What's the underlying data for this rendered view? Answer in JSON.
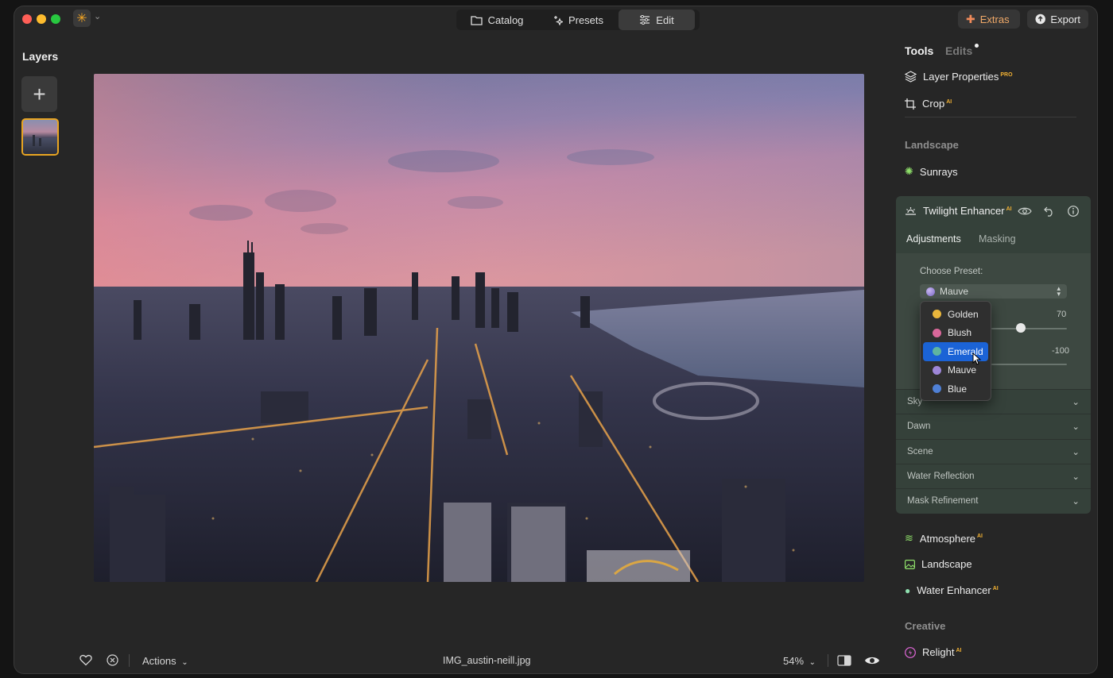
{
  "colors": {
    "accent": "#e8a522",
    "selection": "#1b63d6",
    "ai_badge": "#f0b033"
  },
  "topbar": {
    "tabs": [
      {
        "label": "Catalog",
        "icon": "folder-icon"
      },
      {
        "label": "Presets",
        "icon": "sparkle-icon"
      },
      {
        "label": "Edit",
        "icon": "sliders-icon",
        "active": true
      }
    ],
    "extras_label": "Extras",
    "export_label": "Export"
  },
  "layers": {
    "title": "Layers"
  },
  "bottombar": {
    "actions_label": "Actions",
    "filename": "IMG_austin-neill.jpg",
    "zoom": "54%"
  },
  "rightpanel": {
    "tab_tools": "Tools",
    "tab_edits": "Edits",
    "layer_properties": "Layer Properties",
    "pro_badge": "PRO",
    "ai_badge": "AI",
    "crop": "Crop",
    "section_landscape": "Landscape",
    "sunrays": "Sunrays",
    "twilight": {
      "title": "Twilight Enhancer",
      "tab_adjustments": "Adjustments",
      "tab_masking": "Masking",
      "choose_preset_label": "Choose Preset:",
      "preset_selected": "Mauve",
      "slider1_value": "70",
      "slider2_value": "-100",
      "accordion": [
        "Sky",
        "Dawn",
        "Scene",
        "Water Reflection",
        "Mask Refinement"
      ]
    },
    "atmosphere": "Atmosphere",
    "landscape": "Landscape",
    "water_enhancer": "Water Enhancer",
    "section_creative": "Creative",
    "relight": "Relight"
  },
  "preset_dropdown": {
    "options": [
      {
        "label": "Golden",
        "color": "#e9b63c"
      },
      {
        "label": "Blush",
        "color": "#d9679a"
      },
      {
        "label": "Emerald",
        "color": "#5fb5a0",
        "selected": true
      },
      {
        "label": "Mauve",
        "color": "#9d86d8"
      },
      {
        "label": "Blue",
        "color": "#4f80d6"
      }
    ]
  }
}
